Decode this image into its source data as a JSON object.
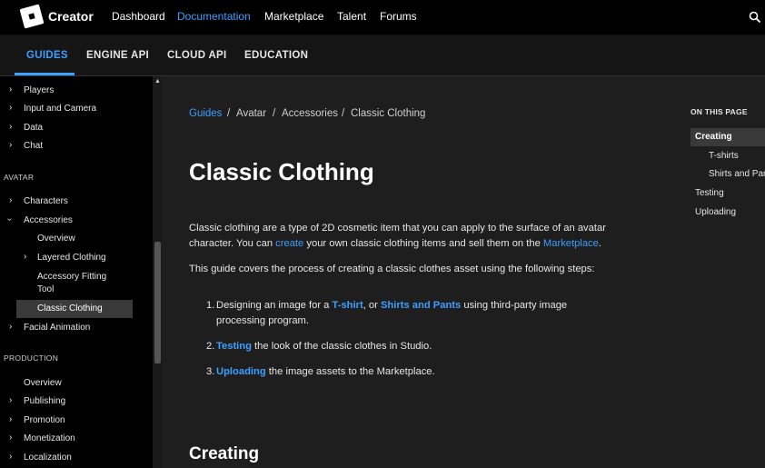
{
  "header": {
    "logo_text": "Creator",
    "nav": [
      "Dashboard",
      "Documentation",
      "Marketplace",
      "Talent",
      "Forums"
    ],
    "active_nav": "Documentation"
  },
  "subnav": {
    "tabs": [
      "GUIDES",
      "ENGINE API",
      "CLOUD API",
      "EDUCATION"
    ],
    "active": "GUIDES"
  },
  "sidebar": {
    "top_items": [
      "Players",
      "Input and Camera",
      "Data",
      "Chat"
    ],
    "avatar_section": "AVATAR",
    "characters": "Characters",
    "accessories": "Accessories",
    "overview": "Overview",
    "layered_clothing": "Layered Clothing",
    "accessory_fitting_1": "Accessory Fitting",
    "accessory_fitting_2": "Tool",
    "classic_clothing": "Classic Clothing",
    "facial_animation": "Facial Animation",
    "production_section": "PRODUCTION",
    "prod_overview": "Overview",
    "publishing": "Publishing",
    "promotion": "Promotion",
    "monetization": "Monetization",
    "localization": "Localization"
  },
  "breadcrumb": [
    "Guides",
    "Avatar",
    "Accessories",
    "Classic Clothing"
  ],
  "content": {
    "title": "Classic Clothing",
    "intro_line1": "Classic clothing are a type of 2D cosmetic item that you can apply to the surface of an avatar",
    "intro_line2_a": "character. You can ",
    "intro_create": "create",
    "intro_line2_b": " your own classic clothing items and sell them on the ",
    "intro_marketplace": "Marketplace",
    "intro_line2_c": ".",
    "guide_line": "This guide covers the process of creating a classic clothes asset using the following steps:",
    "step1_a": "Designing an image for a ",
    "step1_tshirt": "T-shirt",
    "step1_b": ", or ",
    "step1_shirts": "Shirts and Pants",
    "step1_c": " using third-party image",
    "step1_d": "processing program.",
    "step2_link": "Testing",
    "step2_rest": " the look of the classic clothes in Studio.",
    "step3_link": "Uploading",
    "step3_rest": " the image assets to the Marketplace.",
    "creating_heading": "Creating"
  },
  "toc": {
    "title": "ON THIS PAGE",
    "items": [
      "Creating",
      "T-shirts",
      "Shirts and Pants",
      "Testing",
      "Uploading"
    ],
    "active": "Creating"
  },
  "colors": {
    "accent": "#3ca0ff",
    "topbar": "#000000",
    "content_bg": "#1e1e1e"
  }
}
